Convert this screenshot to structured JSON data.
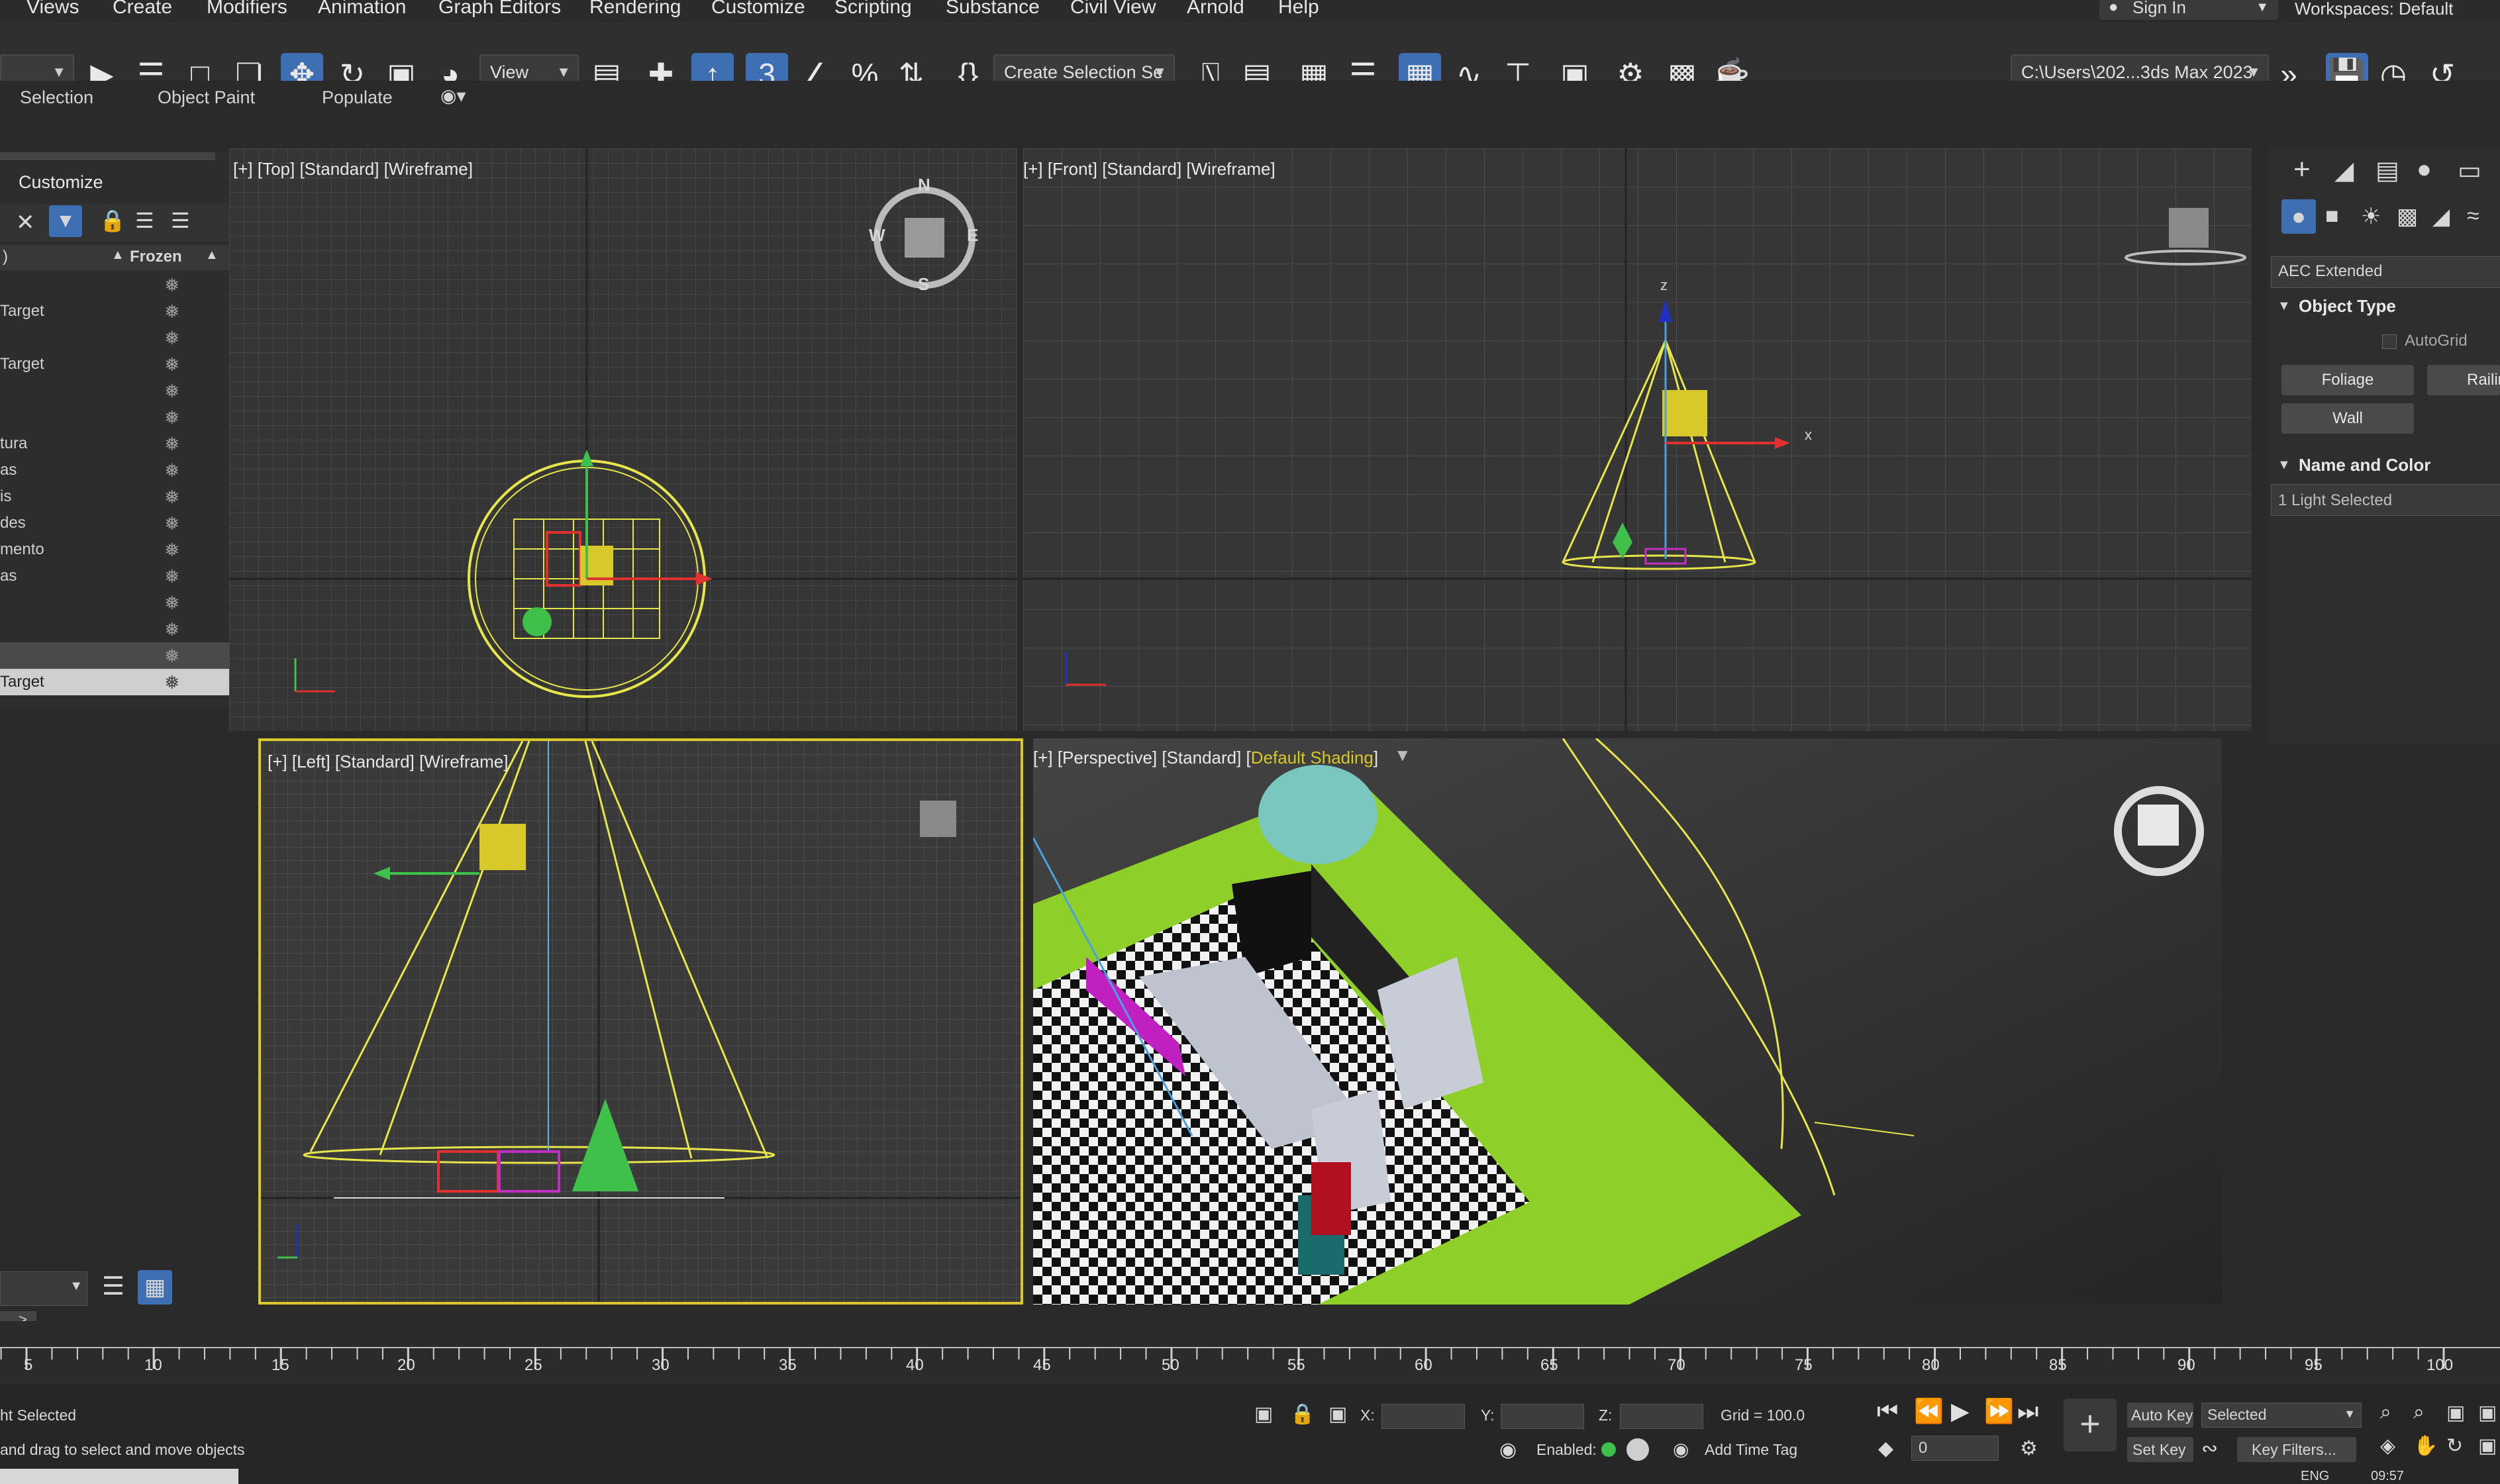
{
  "menu": [
    "Views",
    "Create",
    "Modifiers",
    "Animation",
    "Graph Editors",
    "Rendering",
    "Customize",
    "Scripting",
    "Substance",
    "Civil View",
    "Arnold",
    "Help"
  ],
  "account": {
    "sign_in": "Sign In",
    "workspaces_label": "Workspaces:",
    "workspace": "Default"
  },
  "toolbar": {
    "reference_coord": "View",
    "named_selection": "Create Selection Se",
    "project_path": "C:\\Users\\202...3ds Max 2023"
  },
  "ribbon": {
    "tabs": [
      "Selection",
      "Object Paint",
      "Populate"
    ]
  },
  "explorer": {
    "title": "Customize",
    "column_header": "Frozen",
    "rows": [
      "",
      "Target",
      "",
      "Target",
      "",
      "",
      "tura",
      "as",
      "is",
      "des",
      "mento",
      "as",
      "",
      "",
      "",
      "Target"
    ]
  },
  "viewports": {
    "top": {
      "label": "[+] [Top] [Standard] [Wireframe]",
      "compass": [
        "N",
        "W",
        "E",
        "S"
      ]
    },
    "front": {
      "label": "[+] [Front] [Standard] [Wireframe]",
      "axis_x": "x",
      "axis_z": "z"
    },
    "left": {
      "label": "[+] [Left] [Standard] [Wireframe]"
    },
    "perspective": {
      "label_prefix": "[+] [Perspective] [Standard] [",
      "label_shading": "Default Shading",
      "label_suffix": "]"
    }
  },
  "command_panel": {
    "category": "AEC Extended",
    "object_type_header": "Object Type",
    "autogrid": "AutoGrid",
    "buttons": [
      "Foliage",
      "Railing",
      "Wall"
    ],
    "name_color_header": "Name and Color",
    "selection_info": "1 Light Selected"
  },
  "timeline": {
    "ticks": [
      5,
      10,
      15,
      20,
      25,
      30,
      35,
      40,
      45,
      50,
      55,
      60,
      65,
      70,
      75,
      80,
      85,
      90,
      95,
      100
    ]
  },
  "status": {
    "selection_text": "ht Selected",
    "prompt_text": "and drag to select and move objects",
    "x_label": "X:",
    "y_label": "Y:",
    "z_label": "Z:",
    "grid": "Grid = 100.0",
    "enabled": "Enabled:",
    "add_time_tag": "Add Time Tag",
    "auto_key": "Auto Key",
    "selected_dropdown": "Selected",
    "set_key": "Set Key",
    "key_filters": "Key Filters...",
    "frame": "0",
    "language": "ENG",
    "clock": "09:57"
  },
  "colors": {
    "selection_blue": "#3f6fb3",
    "viewport_grid": "#5a5a5a",
    "light_yellow": "#e6e64a"
  }
}
